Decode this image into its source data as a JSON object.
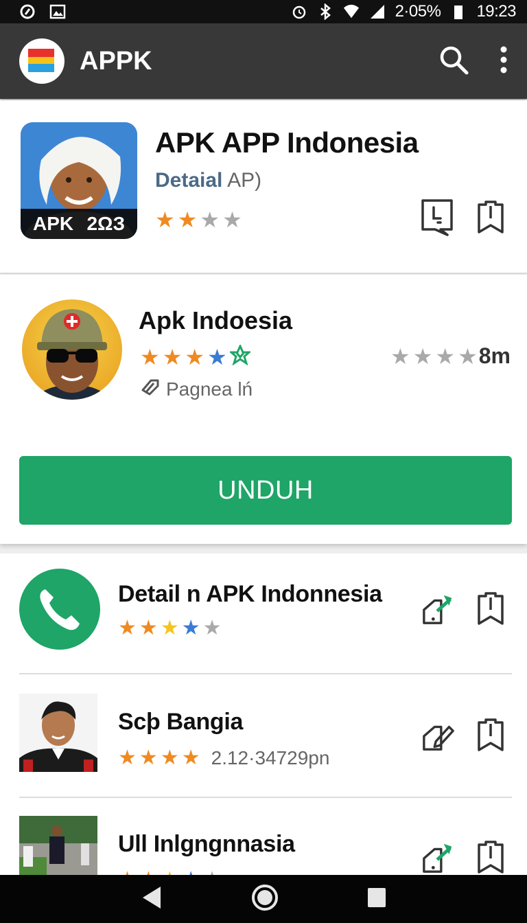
{
  "status_bar": {
    "battery_text": "2·05%",
    "time": "19:23"
  },
  "app_bar": {
    "title": "APPK",
    "search_icon": "search-icon",
    "more_icon": "more-vert-icon"
  },
  "featured": {
    "title": "APK APP Indonesia",
    "subtitle_main": "Detaial",
    "subtitle_extra": "AP)",
    "thumb_caption_left": "APK",
    "thumb_caption_right": "2ΩЗ",
    "rating": 2,
    "stars_total": 4
  },
  "detail": {
    "title": "Apk Indoesia",
    "meta_label": "Pagnea lń",
    "size": "8m",
    "download_label": "UNDUH"
  },
  "list": {
    "items": [
      {
        "title": "Detail n APK Indonnesia",
        "extra": ""
      },
      {
        "title": "Scþ Bangia",
        "extra": "2.12·34729pn"
      },
      {
        "title": "Ull Inlgngnnasia",
        "extra": ""
      }
    ]
  },
  "colors": {
    "accent_green": "#1ea567",
    "app_bar": "#383838",
    "star_orange": "#ef8a22"
  }
}
